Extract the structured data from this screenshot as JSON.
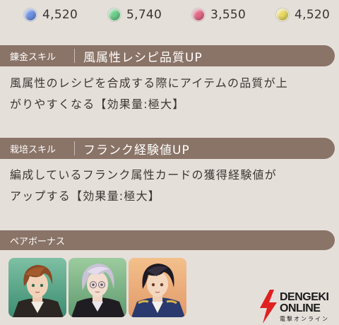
{
  "currencies": [
    {
      "icon": "blue-gem-icon",
      "color": "#6f93e3",
      "amount": "4,520"
    },
    {
      "icon": "green-gem-icon",
      "color": "#6ccf8a",
      "amount": "5,740"
    },
    {
      "icon": "red-gem-icon",
      "color": "#e36a86",
      "amount": "3,550"
    },
    {
      "icon": "yellow-gem-icon",
      "color": "#e8da62",
      "amount": "4,520"
    }
  ],
  "skills": [
    {
      "tag": "錬金スキル",
      "title": "風属性レシピ品質UP",
      "desc_lines": [
        "風属性のレシピを合成する際にアイテムの品質が上",
        "がりやすくなる【効果量:極大】"
      ]
    },
    {
      "tag": "栽培スキル",
      "title": "フランク経験値UP",
      "desc_lines": [
        "編成しているフランク属性カードの獲得経験値が",
        "アップする【効果量:極大】"
      ]
    }
  ],
  "pair_bonus": {
    "label": "ペアボーナス",
    "portraits": [
      "character-portrait-brown-hair",
      "character-portrait-silver-hair",
      "character-portrait-black-hair"
    ]
  },
  "watermark": {
    "line1": "DENGEKI",
    "line2": "ONLINE",
    "line3": "電撃オンライン"
  },
  "colors": {
    "banner": "#8a7367",
    "background": "#e5dfda",
    "text": "#3d3633"
  }
}
